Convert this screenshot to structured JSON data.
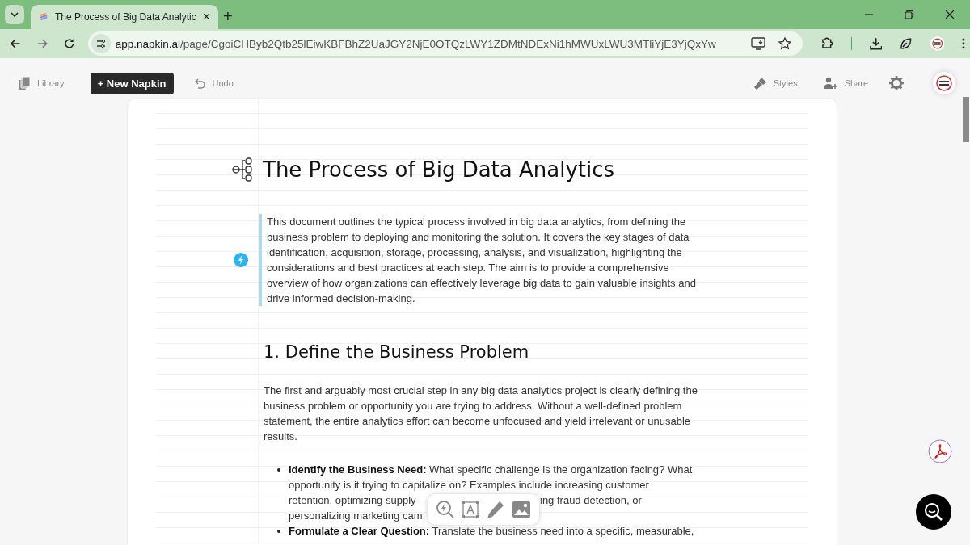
{
  "browser": {
    "tab": {
      "title": "The Process of Big Data Analytic",
      "close": "×",
      "selected": true
    },
    "new_tab": "+",
    "url_host": "app.napkin.ai",
    "url_path": "/page/CgoiCHByb2Qtb25lEiwKBFBhZ2UaJGY2NjE0OTQzLWY1ZDMtNDExNi1hMWUxLWU3MTliYjE3YjQxYw"
  },
  "toolbar": {
    "library": "Library",
    "new_napkin": "+ New Napkin",
    "undo": "Undo",
    "styles": "Styles",
    "share": "Share"
  },
  "document": {
    "title": "The Process of Big Data Analytics",
    "intro": "This document outlines the typical process involved in big data analytics, from defining the business problem to deploying and monitoring the solution. It covers the key stages of data identification, acquisition, storage, processing, analysis, and visualization, highlighting the considerations and best practices at each step. The aim is to provide a comprehensive overview of how organizations can effectively leverage big data to gain valuable insights and drive informed decision-making.",
    "sections": [
      {
        "heading": "1. Define the Business Problem",
        "paragraph": "The first and arguably most crucial step in any big data analytics project is clearly defining the business problem or opportunity you are trying to address. Without a well-defined problem statement, the entire analytics effort can become unfocused and yield irrelevant or unusable results.",
        "bullets": [
          {
            "lines": [
              [
                "**Identify the Business Need:** What specific challenge is the organization facing? What"
              ],
              [
                "opportunity is it trying to capitalize on? Examples include increasing customer"
              ],
              [
                "retention, optimizing supply",
                "ing fraud detection, or"
              ],
              [
                "personalizing marketing cam"
              ]
            ]
          },
          {
            "lines": [
              [
                "**Formulate a Clear Question:** Translate the business need into a specific, measurable,"
              ]
            ]
          }
        ]
      }
    ]
  }
}
